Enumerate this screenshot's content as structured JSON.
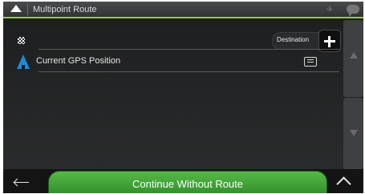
{
  "window": {
    "title": "Multipoint Route"
  },
  "route": {
    "destination_label": "Destination",
    "points": [
      {
        "label": "Current GPS Position"
      }
    ]
  },
  "footer": {
    "continue_label": "Continue Without Route"
  },
  "colors": {
    "accent": "#9aca3c",
    "continue_button": "#3fa035",
    "position_marker": "#1f8ad6",
    "background": "#1b1b1c"
  },
  "icons": {
    "back": "triangle-up-icon",
    "gps": "gps-icon",
    "messages": "speech-bubble-icon",
    "destination": "checkered-flag-icon",
    "add": "plus-icon",
    "position": "position-arrow-icon",
    "details": "details-icon",
    "scroll_up": "scroll-up-icon",
    "scroll_down": "scroll-down-icon",
    "footer_back": "left-arrow-icon",
    "more": "chevron-up-icon"
  }
}
